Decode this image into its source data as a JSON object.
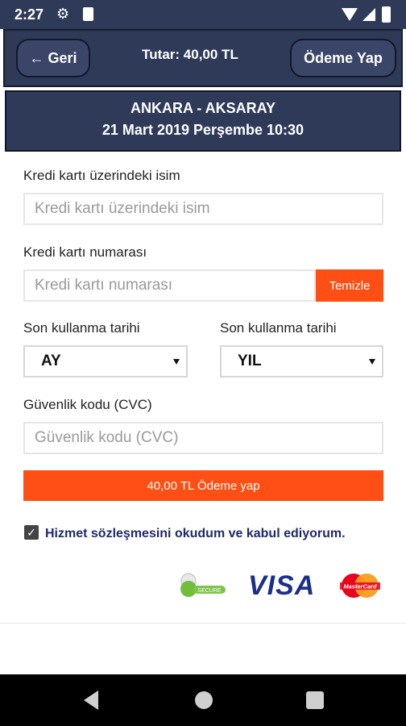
{
  "status_bar": {
    "time": "2:27"
  },
  "header": {
    "back_label": "← Geri",
    "total_label": "Tutar: 40,00 TL",
    "pay_label": "Ödeme Yap"
  },
  "route": {
    "title": "ANKARA - AKSARAY",
    "datetime": "21 Mart 2019 Perşembe 10:30"
  },
  "form": {
    "name_label": "Kredi kartı üzerindeki isim",
    "name_placeholder": "Kredi kartı üzerindeki isim",
    "number_label": "Kredi kartı numarası",
    "number_placeholder": "Kredi kartı numarası",
    "clear_label": "Temizle",
    "expiry_month_label": "Son kullanma tarihi",
    "expiry_year_label": "Son kullanma tarihi",
    "month_value": "AY",
    "year_value": "YIL",
    "cvc_label": "Güvenlik kodu (CVC)",
    "cvc_placeholder": "Güvenlik kodu (CVC)",
    "pay_button_label": "40,00 TL Ödeme yap",
    "agreement_text": "Hizmet sözleşmesini okudum ve kabul ediyorum.",
    "agreement_checked": true
  },
  "logos": {
    "visa": "VISA",
    "secure_text": "SECURE",
    "mastercard_text": "MasterCard"
  },
  "colors": {
    "header_bg": "#2f3a58",
    "accent_orange": "#ff4f14",
    "agreement_text": "#1f2a66"
  }
}
